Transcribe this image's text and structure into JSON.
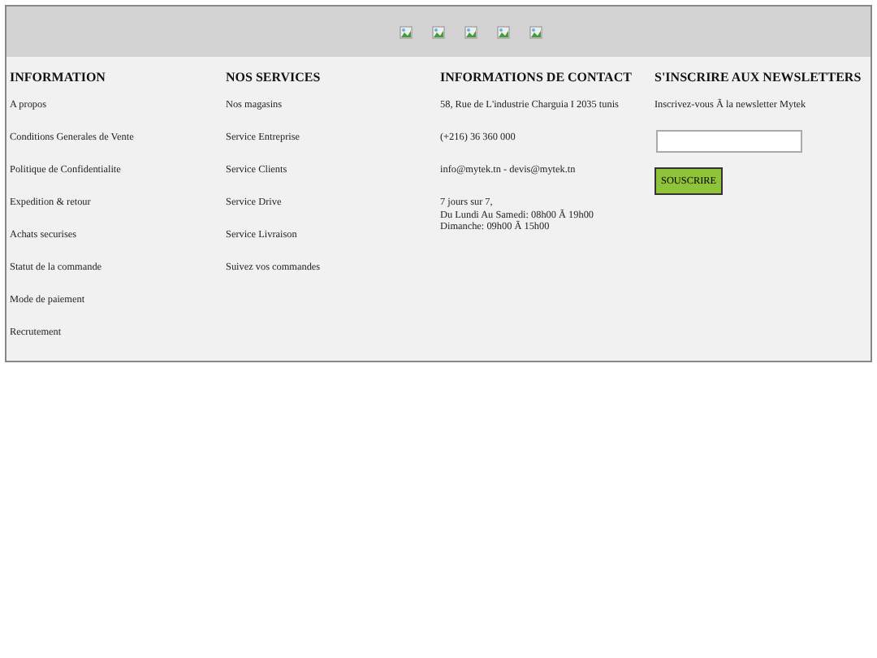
{
  "columns": [
    {
      "title": "INFORMATION",
      "kind": "links",
      "items": [
        "A propos",
        "Conditions Generales de Vente",
        "Politique de Confidentialite",
        "Expedition & retour",
        "Achats securises",
        "Statut de la commande",
        "Mode de paiement",
        "Recrutement"
      ]
    },
    {
      "title": "NOS SERVICES",
      "kind": "links",
      "items": [
        "Nos magasins",
        "Service Entreprise",
        "Service Clients",
        "Service Drive",
        "Service Livraison",
        "Suivez vos commandes"
      ]
    },
    {
      "title": "INFORMATIONS DE CONTACT",
      "kind": "contact",
      "items": [
        "58, Rue de L'industrie Charguia I 2035 tunis",
        "(+216) 36 360 000",
        "info@mytek.tn - devis@mytek.tn"
      ],
      "hours": [
        "7 jours sur 7,",
        "Du Lundi Au Samedi: 08h00 Ã  19h00",
        "Dimanche: 09h00 Ã  15h00"
      ]
    },
    {
      "title": "S'INSCRIRE AUX NEWSLETTERS",
      "kind": "newsletter",
      "text": "Inscrivez-vous Ã  la newsletter Mytek",
      "button": "SOUSCRIRE"
    }
  ]
}
